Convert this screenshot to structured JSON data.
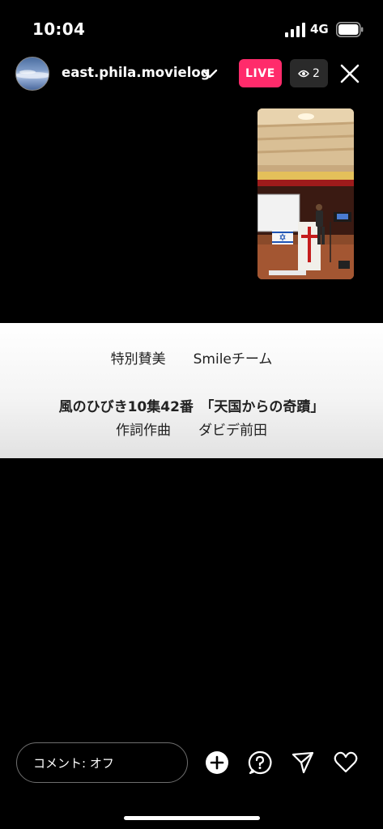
{
  "status_bar": {
    "time": "10:04",
    "network": "4G",
    "icons": [
      "signal-icon",
      "battery-icon"
    ]
  },
  "header": {
    "username": "east.phila.movielog",
    "live_label": "LIVE",
    "viewer_count": "2",
    "icons": [
      "avatar",
      "chevron-down-icon",
      "eye-icon",
      "close-icon"
    ]
  },
  "caption": {
    "line1": "特別賛美　　Smileチーム",
    "line2": "風のひびき10集42番　「天国からの奇蹟」",
    "line3": "作詞作曲　　ダビデ前田"
  },
  "bottom_bar": {
    "comment_placeholder": "コメント: オフ",
    "icons": [
      "add-icon",
      "question-icon",
      "send-icon",
      "heart-icon"
    ]
  },
  "colors": {
    "background": "#000000",
    "live_badge": "#ff2b6b",
    "viewer_badge": "#2a2a2a"
  }
}
